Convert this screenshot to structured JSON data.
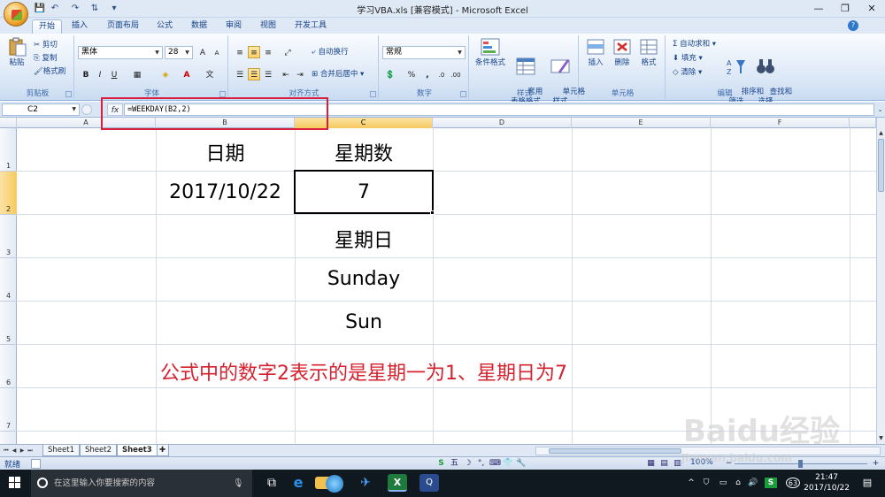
{
  "window": {
    "title": "学习VBA.xls  [兼容模式] - Microsoft Excel",
    "controls": [
      "—",
      "❐",
      "✕"
    ]
  },
  "tabs": [
    "开始",
    "插入",
    "页面布局",
    "公式",
    "数据",
    "审阅",
    "视图",
    "开发工具"
  ],
  "ribbon": {
    "clipboard": {
      "paste": "粘贴",
      "cut": "剪切",
      "copy": "复制",
      "format_painter": "格式刷",
      "label": "剪贴板"
    },
    "font": {
      "name": "黑体",
      "size": "28",
      "bold": "B",
      "italic": "I",
      "underline": "U",
      "label": "字体"
    },
    "alignment": {
      "wrap": "自动换行",
      "merge": "合并后居中",
      "label": "对齐方式"
    },
    "number": {
      "format": "常规",
      "percent": "%",
      "comma": ",",
      "label": "数字"
    },
    "styles": {
      "conditional": "条件格式",
      "table": "套用\n表格格式",
      "cell_style": "单元格\n样式",
      "label": "样式"
    },
    "cells": {
      "insert": "插入",
      "delete": "删除",
      "format": "格式",
      "label": "单元格"
    },
    "editing": {
      "autosum": "自动求和",
      "fill": "填充",
      "clear": "清除",
      "sort": "排序和\n筛选",
      "find": "查找和\n选择",
      "label": "编辑"
    }
  },
  "formula_bar": {
    "name_box": "C2",
    "fx": "fx",
    "formula": "=WEEKDAY(B2,2)"
  },
  "columns": [
    "A",
    "B",
    "C",
    "D",
    "E",
    "F"
  ],
  "selected_column": "C",
  "rows": [
    "1",
    "2",
    "3",
    "4",
    "5",
    "6",
    "7"
  ],
  "selected_row": "2",
  "cells": {
    "B1": "日期",
    "C1": "星期数",
    "B2": "2017/10/22",
    "C2": "7",
    "C3": "星期日",
    "C4": "Sunday",
    "C5": "Sun"
  },
  "note": "公式中的数字2表示的是星期一为1、星期日为7",
  "sheets": [
    "Sheet1",
    "Sheet2",
    "Sheet3"
  ],
  "active_sheet": "Sheet3",
  "status": {
    "mode": "就绪",
    "zoom": "100%"
  },
  "taskbar": {
    "search_placeholder": "在这里输入你要搜索的内容",
    "time": "21:47",
    "date": "2017/10/22",
    "tray_badge": "63"
  },
  "watermark": {
    "brand": "Baidu经验",
    "url": "jingyan.baidu.com"
  },
  "colors": {
    "accent_red": "#d6212e",
    "highlight_box": "#d91d3c",
    "ribbon_text": "#15428b"
  }
}
